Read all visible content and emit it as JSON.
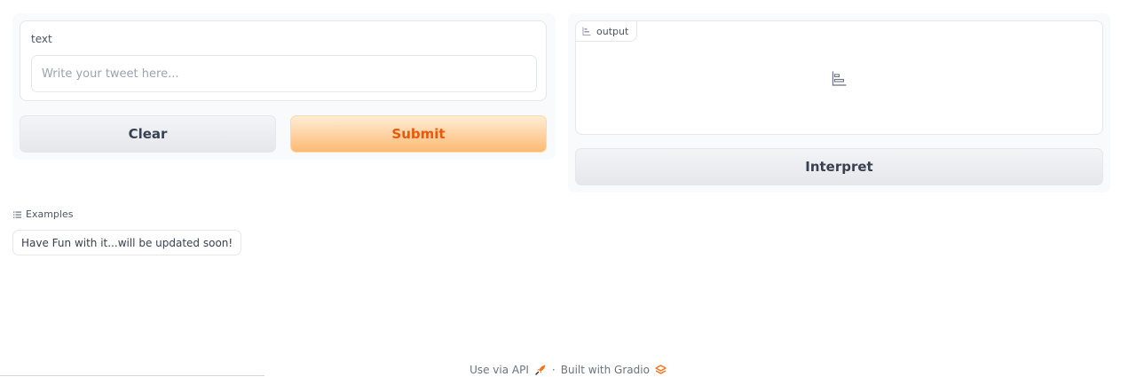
{
  "input": {
    "label": "text",
    "placeholder": "Write your tweet here...",
    "value": ""
  },
  "buttons": {
    "clear": "Clear",
    "submit": "Submit",
    "interpret": "Interpret"
  },
  "output": {
    "label": "output",
    "icon": "bar-chart-icon"
  },
  "examples": {
    "header": "Examples",
    "items": [
      "Have Fun with it...will be updated soon!"
    ]
  },
  "footer": {
    "api_link": "Use via API",
    "separator": "·",
    "built_with": "Built with Gradio"
  },
  "colors": {
    "accent": "#ea580c",
    "submit_gradient_start": "#ffedd5",
    "submit_gradient_end": "#fdba74",
    "panel_bg": "#f9fafb",
    "border": "#e5e7eb"
  }
}
